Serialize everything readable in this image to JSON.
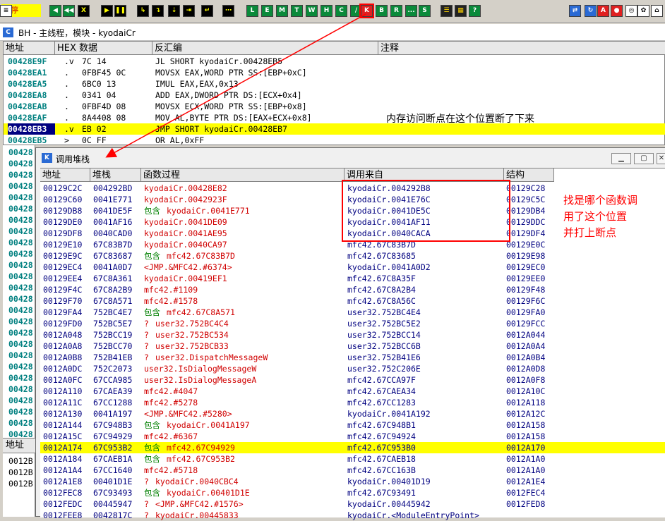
{
  "toolbar": {
    "status": "暂停",
    "buttons": [
      {
        "label": "◀",
        "style": "g"
      },
      {
        "label": "◀◀",
        "style": "g"
      },
      {
        "label": "X",
        "style": "k"
      },
      {
        "label": "▶",
        "style": "k"
      },
      {
        "label": "❚❚",
        "style": "k"
      },
      {
        "label": "↳",
        "style": "k"
      },
      {
        "label": "↴",
        "style": "k"
      },
      {
        "label": "⇣",
        "style": "k"
      },
      {
        "label": "⇥",
        "style": "k"
      },
      {
        "label": "↵",
        "style": "k"
      },
      {
        "label": "⋯",
        "style": "k"
      },
      {
        "label": "L",
        "style": "g"
      },
      {
        "label": "E",
        "style": "g"
      },
      {
        "label": "M",
        "style": "g"
      },
      {
        "label": "T",
        "style": "g"
      },
      {
        "label": "W",
        "style": "g"
      },
      {
        "label": "H",
        "style": "g"
      },
      {
        "label": "C",
        "style": "g"
      },
      {
        "label": "/",
        "style": "g"
      },
      {
        "label": "K",
        "style": "red"
      },
      {
        "label": "B",
        "style": "g"
      },
      {
        "label": "R",
        "style": "g"
      },
      {
        "label": "...",
        "style": "g"
      },
      {
        "label": "S",
        "style": "g"
      },
      {
        "label": "☰",
        "style": "y"
      },
      {
        "label": "▦",
        "style": "y"
      },
      {
        "label": "?",
        "style": "g"
      },
      {
        "label": "⇄",
        "style": "blu"
      },
      {
        "label": "↻",
        "style": "blu"
      },
      {
        "label": "A",
        "style": "red"
      },
      {
        "label": "●",
        "style": "red"
      },
      {
        "label": "◎",
        "style": "wht"
      },
      {
        "label": "✿",
        "style": "wht"
      },
      {
        "label": "⌂",
        "style": "wht"
      },
      {
        "label": "≡",
        "style": "wht"
      }
    ]
  },
  "main_window": {
    "title": "BH - 主线程，模块 - kyodaiCr",
    "headers": [
      "地址",
      "HEX 数据",
      "反汇编",
      "注释"
    ],
    "rows": [
      {
        "addr": "00428E9F",
        "mark": ".v",
        "hex": "7C 14",
        "asm": "JL SHORT kyodaiCr.00428EB5"
      },
      {
        "addr": "00428EA1",
        "mark": ".",
        "hex": "0FBF45 0C",
        "asm": "MOVSX EAX,WORD PTR SS:[EBP+0xC]"
      },
      {
        "addr": "00428EA5",
        "mark": ".",
        "hex": "6BC0 13",
        "asm": "IMUL EAX,EAX,0x13"
      },
      {
        "addr": "00428EA8",
        "mark": ".",
        "hex": "0341 04",
        "asm": "ADD EAX,DWORD PTR DS:[ECX+0x4]"
      },
      {
        "addr": "00428EAB",
        "mark": ".",
        "hex": "0FBF4D 08",
        "asm": "MOVSX ECX,WORD PTR SS:[EBP+0x8]"
      },
      {
        "addr": "00428EAF",
        "mark": ".",
        "hex": "8A4408 08",
        "asm": "MOV AL,BYTE PTR DS:[EAX+ECX+0x8]"
      },
      {
        "addr": "00428EB3",
        "mark": ".v",
        "hex": "EB 02",
        "asm": "JMP SHORT kyodaiCr.00428EB7"
      },
      {
        "addr": "00428EB5",
        "mark": ">",
        "hex": "0C FF",
        "asm": "OR AL,0xFF"
      }
    ],
    "comment": "内存访问断点在这个位置断了下来",
    "left_addrs": [
      "00428",
      "00428",
      "00428",
      "00428",
      "00428",
      "00428",
      "00428",
      "00428",
      "00428",
      "00428",
      "00428",
      "00428",
      "00428",
      "00428",
      "00428",
      "00428",
      "00428",
      "00428",
      "00428",
      "00428",
      "00428",
      "00428",
      "00428",
      "00428",
      "00428",
      "00428"
    ],
    "bottom_header": "地址",
    "bottom_addrs": [
      "0012B",
      "0012B",
      "0012B"
    ]
  },
  "callstack": {
    "title": "调用堆栈",
    "headers": [
      "地址",
      "堆栈",
      "函数过程",
      "调用来自",
      "结构"
    ],
    "rows": [
      [
        "00129C2C",
        "004292BD",
        "",
        "kyodaiCr.00428E82",
        "kyodaiCr.004292B8",
        "00129C28"
      ],
      [
        "00129C60",
        "0041E771",
        "",
        "kyodaiCr.0042923F",
        "kyodaiCr.0041E76C",
        "00129C5C"
      ],
      [
        "00129DB8",
        "0041DE5F",
        "包含",
        "kyodaiCr.0041E771",
        "kyodaiCr.0041DE5C",
        "00129DB4"
      ],
      [
        "00129DE0",
        "0041AF16",
        "",
        "kyodaiCr.0041DE09",
        "kyodaiCr.0041AF11",
        "00129DDC"
      ],
      [
        "00129DF8",
        "0040CAD0",
        "",
        "kyodaiCr.0041AE95",
        "kyodaiCr.0040CACA",
        "00129DF4"
      ],
      [
        "00129E10",
        "67C83B7D",
        "",
        "kyodaiCr.0040CA97",
        "mfc42.67C83B7D",
        "00129E0C"
      ],
      [
        "00129E9C",
        "67C83687",
        "包含",
        "mfc42.67C83B7D",
        "mfc42.67C83685",
        "00129E98"
      ],
      [
        "00129EC4",
        "0041A0D7",
        "",
        "<JMP.&MFC42.#6374>",
        "kyodaiCr.0041A0D2",
        "00129EC0"
      ],
      [
        "00129EE4",
        "67C8A361",
        "",
        "kyodaiCr.00419EF1",
        "mfc42.67C8A35F",
        "00129EE0"
      ],
      [
        "00129F4C",
        "67C8A2B9",
        "",
        "mfc42.#1109",
        "mfc42.67C8A2B4",
        "00129F48"
      ],
      [
        "00129F70",
        "67C8A571",
        "",
        "mfc42.#1578",
        "mfc42.67C8A56C",
        "00129F6C"
      ],
      [
        "00129FA4",
        "752BC4E7",
        "包含",
        "mfc42.67C8A571",
        "user32.752BC4E4",
        "00129FA0"
      ],
      [
        "00129FD0",
        "752BC5E7",
        "? ",
        "user32.752BC4C4",
        "user32.752BC5E2",
        "00129FCC"
      ],
      [
        "0012A048",
        "752BCC19",
        "? ",
        "user32.752BC534",
        "user32.752BCC14",
        "0012A044"
      ],
      [
        "0012A0A8",
        "752BCC70",
        "? ",
        "user32.752BCB33",
        "user32.752BCC6B",
        "0012A0A4"
      ],
      [
        "0012A0B8",
        "752B41EB",
        "? ",
        "user32.DispatchMessageW",
        "user32.752B41E6",
        "0012A0B4"
      ],
      [
        "0012A0DC",
        "752C2073",
        "",
        "user32.IsDialogMessageW",
        "user32.752C206E",
        "0012A0D8"
      ],
      [
        "0012A0FC",
        "67CCA985",
        "",
        "user32.IsDialogMessageA",
        "mfc42.67CCA97F",
        "0012A0F8"
      ],
      [
        "0012A110",
        "67CAEA39",
        "",
        "mfc42.#4047",
        "mfc42.67CAEA34",
        "0012A10C"
      ],
      [
        "0012A11C",
        "67CC1288",
        "",
        "mfc42.#5278",
        "mfc42.67CC1283",
        "0012A118"
      ],
      [
        "0012A130",
        "0041A197",
        "",
        "<JMP.&MFC42.#5280>",
        "kyodaiCr.0041A192",
        "0012A12C"
      ],
      [
        "0012A144",
        "67C948B3",
        "包含",
        "kyodaiCr.0041A197",
        "mfc42.67C948B1",
        "0012A158"
      ],
      [
        "0012A15C",
        "67C94929",
        "",
        "mfc42.#6367",
        "mfc42.67C94924",
        "0012A158"
      ],
      [
        "0012A174",
        "67C953B2",
        "包含",
        "mfc42.67C94929",
        "mfc42.67C953B0",
        "0012A170"
      ],
      [
        "0012A184",
        "67CAEB1A",
        "包含",
        "mfc42.67C953B2",
        "mfc42.67CAEB18",
        "0012A1A0"
      ],
      [
        "0012A1A4",
        "67CC1640",
        "",
        "mfc42.#5718",
        "mfc42.67CC163B",
        "0012A1A0"
      ],
      [
        "0012A1E8",
        "00401D1E",
        "? ",
        "kyodaiCr.0040CBC4",
        "kyodaiCr.00401D19",
        "0012A1E4"
      ],
      [
        "0012FEC8",
        "67C93493",
        "包含",
        "kyodaiCr.00401D1E",
        "mfc42.67C93491",
        "0012FEC4"
      ],
      [
        "0012FEDC",
        "00445947",
        "? ",
        "<JMP.&MFC42.#1576>",
        "kyodaiCr.00445942",
        "0012FED8"
      ],
      [
        "0012FEE8",
        "0042817C",
        "? ",
        "kyodaiCr.00445833",
        "kyodaiCr.<ModuleEntryPoint>",
        ""
      ]
    ],
    "note": [
      "找是哪个函数调",
      "用了这个位置",
      "并打上断点"
    ]
  },
  "colors": {
    "highlight": "#ffff00",
    "annotation": "#ff0000",
    "selected": "#000080"
  }
}
